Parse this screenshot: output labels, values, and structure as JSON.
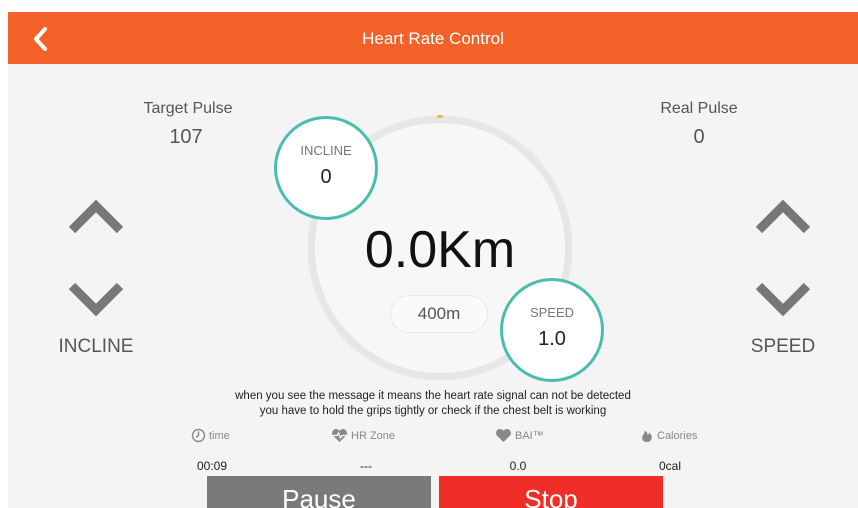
{
  "header": {
    "title": "Heart Rate Control"
  },
  "pulse": {
    "target_label": "Target Pulse",
    "target_value": "107",
    "real_label": "Real Pulse",
    "real_value": "0"
  },
  "controls": {
    "incline_label": "INCLINE",
    "speed_label": "SPEED"
  },
  "display": {
    "distance": "0.0Km",
    "lap": "400m",
    "incline_label": "INCLINE",
    "incline_value": "0",
    "speed_label": "SPEED",
    "speed_value": "1.0"
  },
  "message": {
    "line1": "when you see the message it means the heart rate signal can not be detected",
    "line2": "you have to hold the grips tightly or check if the chest belt is working"
  },
  "stats": {
    "time_label": "time",
    "time_value": "00:09",
    "hrzone_label": "HR Zone",
    "hrzone_value": "---",
    "bai_label": "BAI™",
    "bai_value": "0.0",
    "calories_label": "Calories",
    "calories_value": "0cal"
  },
  "buttons": {
    "pause": "Pause",
    "stop": "Stop"
  },
  "colors": {
    "accent": "#f4622a",
    "teal": "#4bbdb0",
    "stop": "#f12d28",
    "pause": "#7a7a7a"
  },
  "icons": [
    "back-arrow-icon",
    "chevron-up-icon",
    "chevron-down-icon",
    "clock-icon",
    "heart-pulse-icon",
    "heart-icon",
    "flame-icon"
  ]
}
